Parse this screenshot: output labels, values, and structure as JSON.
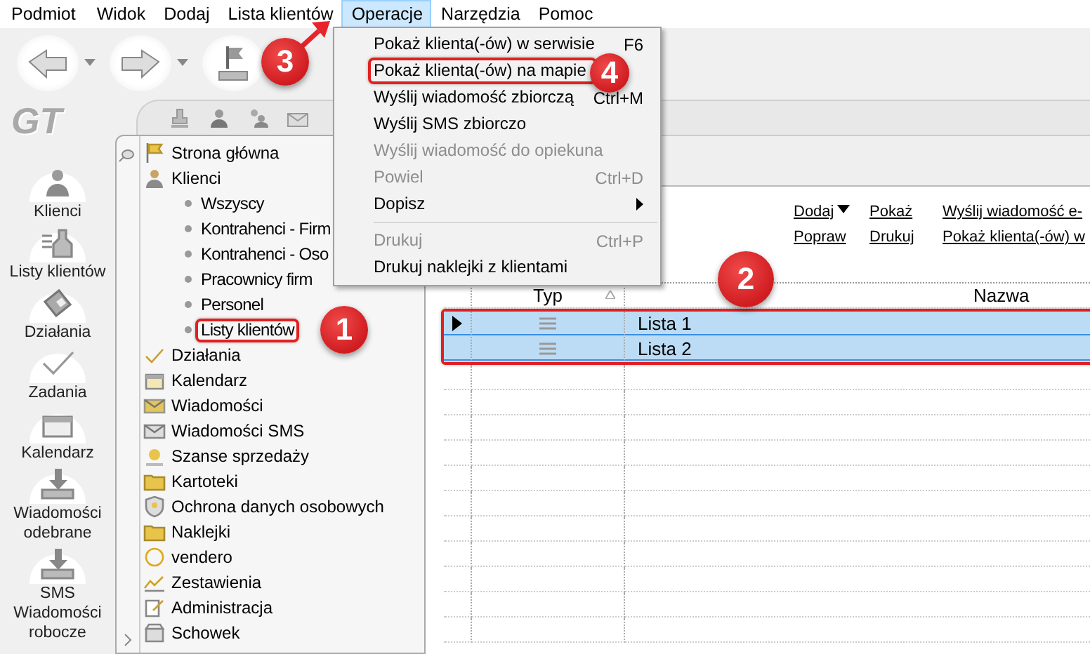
{
  "menubar": [
    {
      "label": "Podmiot",
      "selected": false
    },
    {
      "label": "Widok",
      "selected": false
    },
    {
      "label": "Dodaj",
      "selected": false
    },
    {
      "label": "Lista klientów",
      "selected": false
    },
    {
      "label": "Operacje",
      "selected": true
    },
    {
      "label": "Narzędzia",
      "selected": false
    },
    {
      "label": "Pomoc",
      "selected": false
    }
  ],
  "logo": "GT",
  "nav": [
    {
      "label": "Klienci"
    },
    {
      "label": "Listy klientów"
    },
    {
      "label": "Działania"
    },
    {
      "label": "Zadania"
    },
    {
      "label": "Kalendarz"
    },
    {
      "label": "Wiadomości odebrane"
    },
    {
      "label": "SMS Wiadomości robocze"
    }
  ],
  "tree": [
    {
      "label": "Strona główna"
    },
    {
      "label": "Klienci",
      "children": [
        {
          "label": "Wszyscy",
          "highlighted": false
        },
        {
          "label": "Kontrahenci - Firm",
          "highlighted": false
        },
        {
          "label": "Kontrahenci - Oso",
          "highlighted": false
        },
        {
          "label": "Pracownicy firm",
          "highlighted": false
        },
        {
          "label": "Personel",
          "highlighted": false
        },
        {
          "label": "Listy klientów",
          "highlighted": true
        }
      ]
    },
    {
      "label": "Działania"
    },
    {
      "label": "Kalendarz"
    },
    {
      "label": "Wiadomości"
    },
    {
      "label": "Wiadomości SMS"
    },
    {
      "label": "Szanse sprzedaży"
    },
    {
      "label": "Kartoteki"
    },
    {
      "label": "Ochrona danych osobowych"
    },
    {
      "label": "Naklejki"
    },
    {
      "label": "vendero"
    },
    {
      "label": "Zestawienia"
    },
    {
      "label": "Administracja"
    },
    {
      "label": "Schowek"
    }
  ],
  "actions": [
    {
      "label": "Dodaj",
      "dropdown": true
    },
    {
      "label": "Pokaż",
      "dropdown": false
    },
    {
      "label": "Wyślij wiadomość e-",
      "dropdown": false
    },
    {
      "label": "Popraw",
      "dropdown": false
    },
    {
      "label": "Drukuj",
      "dropdown": false
    },
    {
      "label": "Pokaż klienta(-ów) w",
      "dropdown": false
    }
  ],
  "grid": {
    "highlighted": true,
    "columns": [
      {
        "label": "Typ",
        "sorted": true
      },
      {
        "label": "Nazwa",
        "sorted": false
      }
    ],
    "rows": [
      {
        "name": "Lista 1",
        "current": true,
        "selected": true
      },
      {
        "name": "Lista 2",
        "current": false,
        "selected": true
      }
    ]
  },
  "menu": {
    "items": [
      {
        "kind": "item",
        "label": "Pokaż klienta(-ów) w serwisie",
        "shortcut": "F6",
        "disabled": false,
        "highlighted": false,
        "submenu": false
      },
      {
        "kind": "item",
        "label": "Pokaż klienta(-ów) na mapie",
        "disabled": false,
        "highlighted": true,
        "submenu": false
      },
      {
        "kind": "item",
        "label": "Wyślij wiadomość zbiorczą",
        "shortcut": "Ctrl+M",
        "disabled": false,
        "highlighted": false,
        "submenu": false
      },
      {
        "kind": "item",
        "label": "Wyślij SMS zbiorczo",
        "disabled": false,
        "highlighted": false,
        "submenu": false
      },
      {
        "kind": "item",
        "label": "Wyślij wiadomość do opiekuna",
        "disabled": true,
        "highlighted": false,
        "submenu": false
      },
      {
        "kind": "item",
        "label": "Powiel",
        "shortcut": "Ctrl+D",
        "disabled": true,
        "highlighted": false,
        "submenu": false
      },
      {
        "kind": "item",
        "label": "Dopisz",
        "disabled": false,
        "highlighted": false,
        "submenu": true
      },
      {
        "kind": "separator"
      },
      {
        "kind": "item",
        "label": "Drukuj",
        "shortcut": "Ctrl+P",
        "disabled": true,
        "highlighted": false,
        "submenu": false
      },
      {
        "kind": "item",
        "label": "Drukuj naklejki z klientami",
        "disabled": false,
        "highlighted": false,
        "submenu": false
      }
    ]
  },
  "annotations": [
    {
      "number": "1",
      "arrow": false
    },
    {
      "number": "2",
      "arrow": false
    },
    {
      "number": "3",
      "arrow": true
    },
    {
      "number": "4",
      "arrow": false
    }
  ]
}
